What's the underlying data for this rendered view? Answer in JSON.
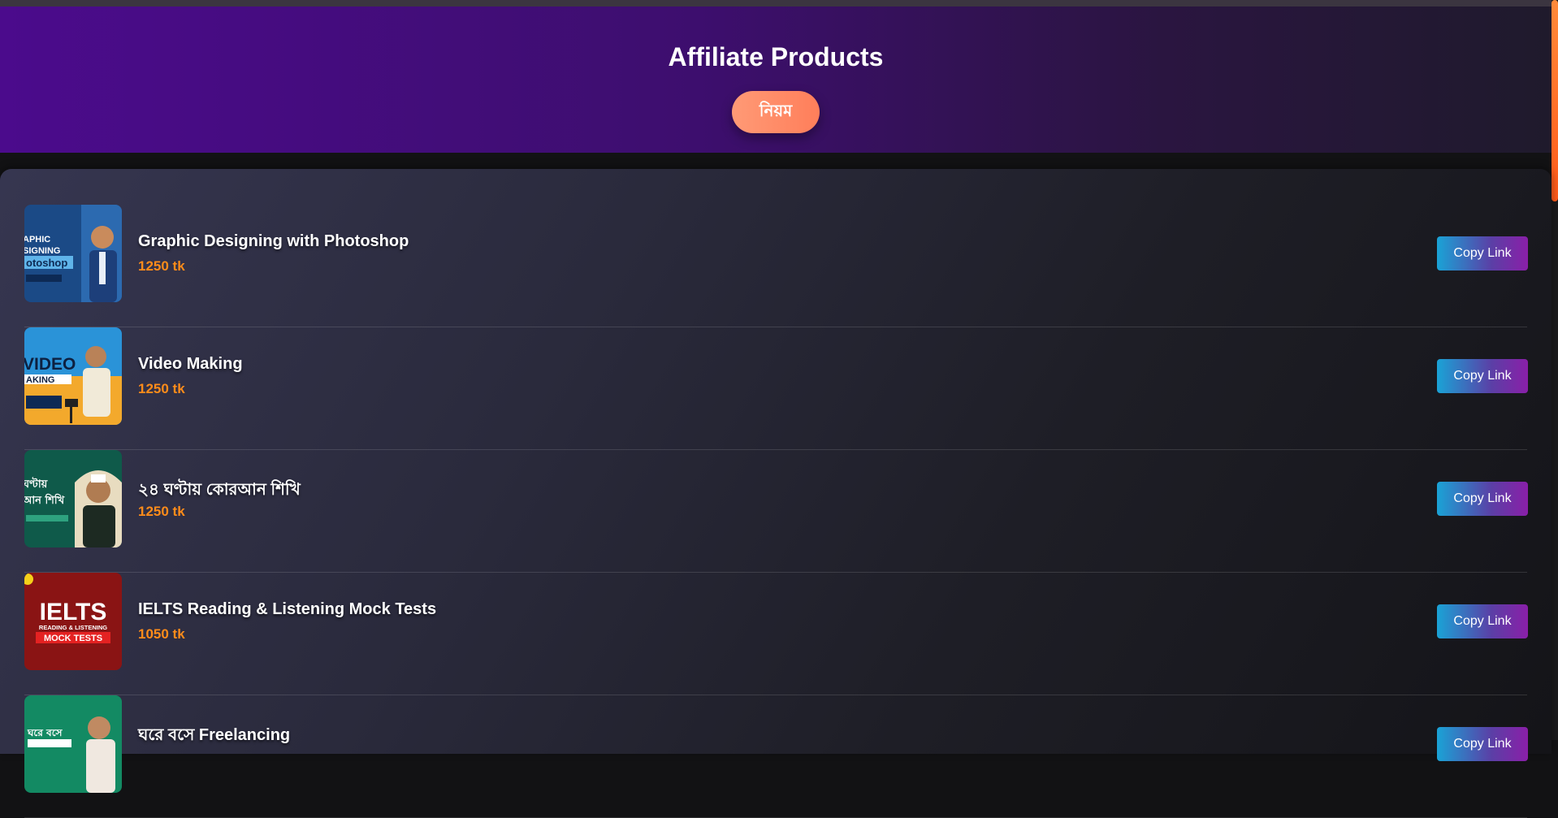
{
  "header": {
    "title": "Affiliate Products",
    "rules_label": "নিয়ম"
  },
  "products": [
    {
      "name": "Graphic Designing with Photoshop",
      "price": "1250 tk",
      "copy_label": "Copy Link",
      "thumb_text": [
        "APHIC",
        "SIGNING",
        "otoshop"
      ],
      "thumb_bg": "#1b4a86"
    },
    {
      "name": "Video Making",
      "price": "1250 tk",
      "copy_label": "Copy Link",
      "thumb_text": [
        "VIDEO",
        "AKING"
      ],
      "thumb_bg": "#2a93d8"
    },
    {
      "name": "২৪ ঘণ্টায় কোরআন শিখি",
      "price": "1250 tk",
      "copy_label": "Copy Link",
      "thumb_text": [
        "ঘণ্টায়",
        "আন শিখি"
      ],
      "thumb_bg": "#0f5a4a"
    },
    {
      "name": "IELTS Reading & Listening Mock Tests",
      "price": "1050 tk",
      "copy_label": "Copy Link",
      "thumb_text": [
        "IELTS",
        "READING & LISTENING",
        "MOCK TESTS"
      ],
      "thumb_bg": "#8a1414"
    },
    {
      "name": "ঘরে বসে Freelancing",
      "price": "",
      "copy_label": "Copy Link",
      "thumb_text": [
        "ঘরে বসে"
      ],
      "thumb_bg": "#138a63"
    }
  ]
}
